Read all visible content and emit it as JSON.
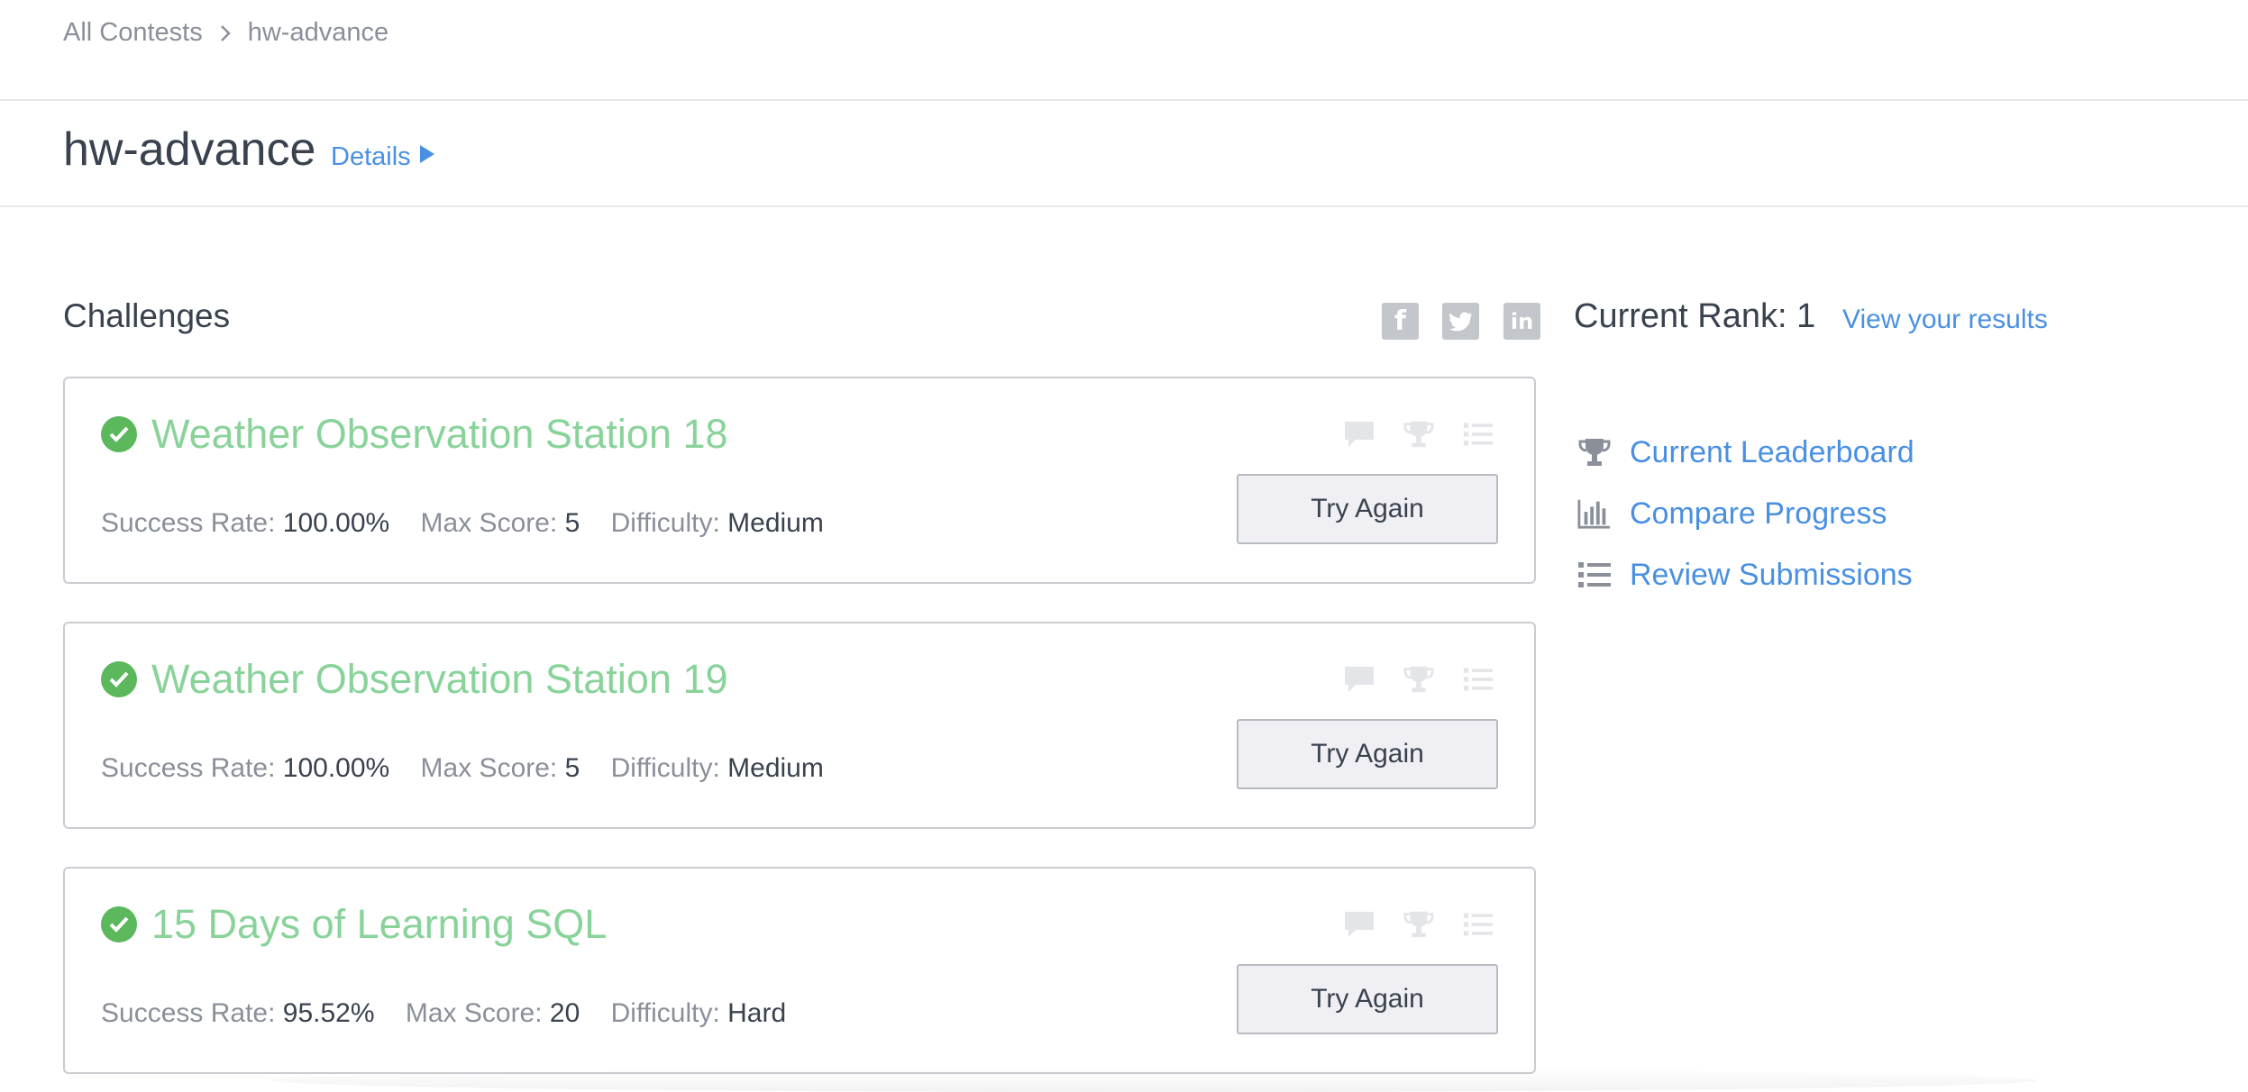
{
  "breadcrumb": {
    "root": "All Contests",
    "current": "hw-advance"
  },
  "header": {
    "title": "hw-advance",
    "details_label": "Details"
  },
  "challenges_section": {
    "title": "Challenges"
  },
  "social": {
    "facebook": "f",
    "twitter": "t",
    "linkedin": "in"
  },
  "rank": {
    "label": "Current Rank: 1",
    "view_results": "View your results"
  },
  "sidebar": {
    "items": [
      {
        "label": "Current Leaderboard",
        "icon": "trophy-icon"
      },
      {
        "label": "Compare Progress",
        "icon": "bar-chart-icon"
      },
      {
        "label": "Review Submissions",
        "icon": "list-icon"
      }
    ]
  },
  "challenges": [
    {
      "title": "Weather Observation Station 18",
      "success_label": "Success Rate:",
      "success_rate": "100.00%",
      "max_label": "Max Score:",
      "max_score": "5",
      "difficulty_label": "Difficulty:",
      "difficulty": "Medium",
      "button": "Try Again"
    },
    {
      "title": "Weather Observation Station 19",
      "success_label": "Success Rate:",
      "success_rate": "100.00%",
      "max_label": "Max Score:",
      "max_score": "5",
      "difficulty_label": "Difficulty:",
      "difficulty": "Medium",
      "button": "Try Again"
    },
    {
      "title": "15 Days of Learning SQL",
      "success_label": "Success Rate:",
      "success_rate": "95.52%",
      "max_label": "Max Score:",
      "max_score": "20",
      "difficulty_label": "Difficulty:",
      "difficulty": "Hard",
      "button": "Try Again"
    }
  ],
  "colors": {
    "link": "#4a90e2",
    "solved_title": "#89d39a",
    "check": "#5cb85c",
    "text": "#39424e",
    "muted": "#8a8f99"
  }
}
